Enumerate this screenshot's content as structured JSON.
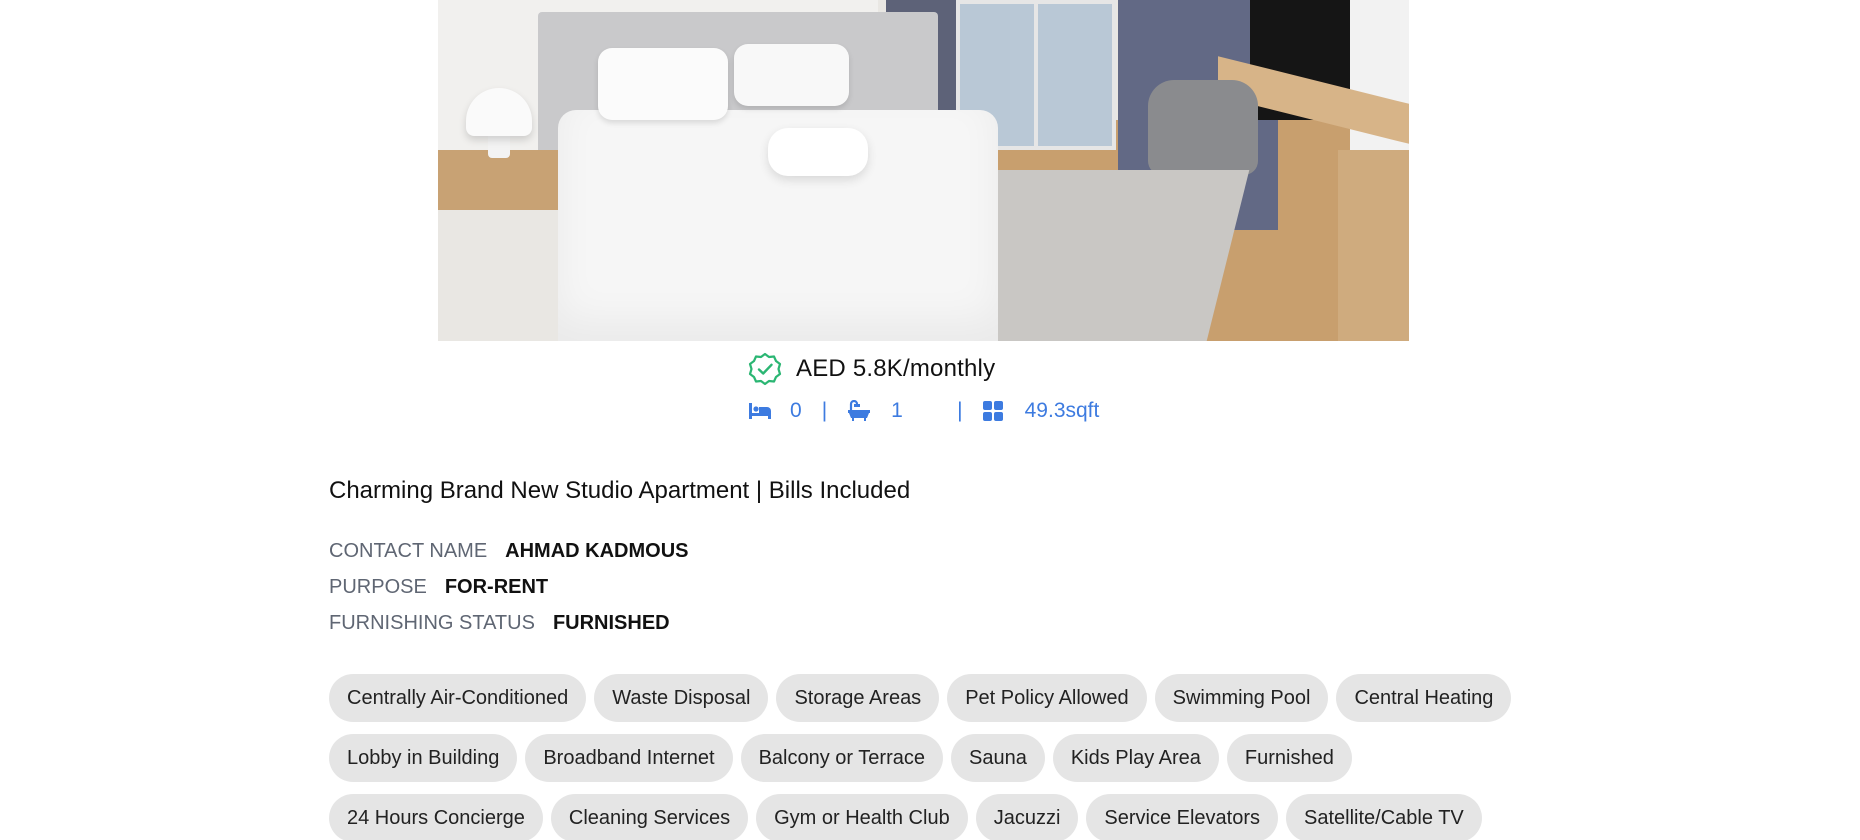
{
  "hero_image": {
    "alt_icon": "bedroom-photo"
  },
  "listing": {
    "price": "AED 5.8K/monthly",
    "verified_icon": "verified-badge-icon",
    "bedrooms": "0",
    "bathrooms": "1",
    "area": "49.3sqft",
    "separator": "|",
    "title": "Charming Brand New Studio Apartment | Bills Included"
  },
  "details": [
    {
      "label": "CONTACT NAME",
      "value": "AHMAD KADMOUS"
    },
    {
      "label": "PURPOSE",
      "value": "FOR-RENT"
    },
    {
      "label": "FURNISHING STATUS",
      "value": "FURNISHED"
    }
  ],
  "amenities": [
    "Centrally Air-Conditioned",
    "Waste Disposal",
    "Storage Areas",
    "Pet Policy Allowed",
    "Swimming Pool",
    "Central Heating",
    "Lobby in Building",
    "Broadband Internet",
    "Balcony or Terrace",
    "Sauna",
    "Kids Play Area",
    "Furnished",
    "24 Hours Concierge",
    "Cleaning Services",
    "Gym or Health Club",
    "Jacuzzi",
    "Service Elevators",
    "Satellite/Cable TV"
  ],
  "colors": {
    "accent_blue": "#3d7be0",
    "verified_green": "#2bb673",
    "chip_bg": "#e5e5e5",
    "label_gray": "#5f6673"
  }
}
